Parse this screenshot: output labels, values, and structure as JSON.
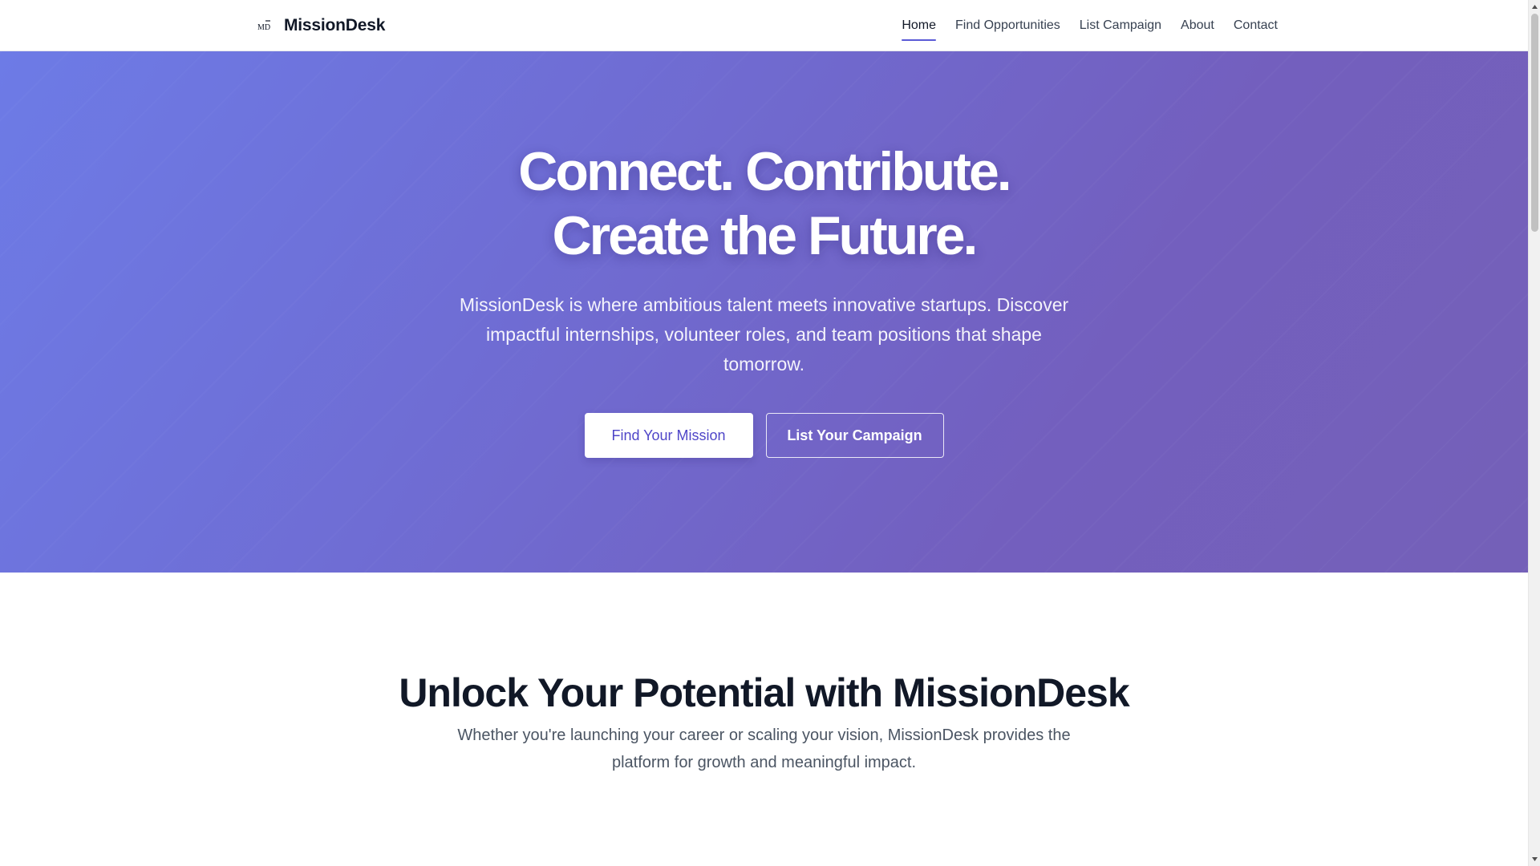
{
  "brand": {
    "logo_text": "MD",
    "name": "MissionDesk"
  },
  "nav": {
    "items": [
      {
        "label": "Home",
        "active": true
      },
      {
        "label": "Find Opportunities",
        "active": false
      },
      {
        "label": "List Campaign",
        "active": false
      },
      {
        "label": "About",
        "active": false
      },
      {
        "label": "Contact",
        "active": false
      }
    ]
  },
  "hero": {
    "title_line1": "Connect. Contribute.",
    "title_line2": "Create the Future.",
    "subtitle": "MissionDesk is where ambitious talent meets innovative startups. Discover impactful internships, volunteer roles, and team positions that shape tomorrow.",
    "primary_button": "Find Your Mission",
    "secondary_button": "List Your Campaign"
  },
  "features": {
    "title": "Unlock Your Potential with MissionDesk",
    "subtitle": "Whether you're launching your career or scaling your vision, MissionDesk provides the platform for growth and meaningful impact."
  },
  "colors": {
    "accent": "#5b5bd6",
    "hero_gradient_start": "#6d7be6",
    "hero_gradient_end": "#7460b8",
    "primary_button_text": "#4f46c8"
  },
  "icons": {
    "logo": "missiondesk-logo-icon",
    "scroll_up": "scroll-up-arrow-icon",
    "scroll_down": "scroll-down-arrow-icon"
  }
}
